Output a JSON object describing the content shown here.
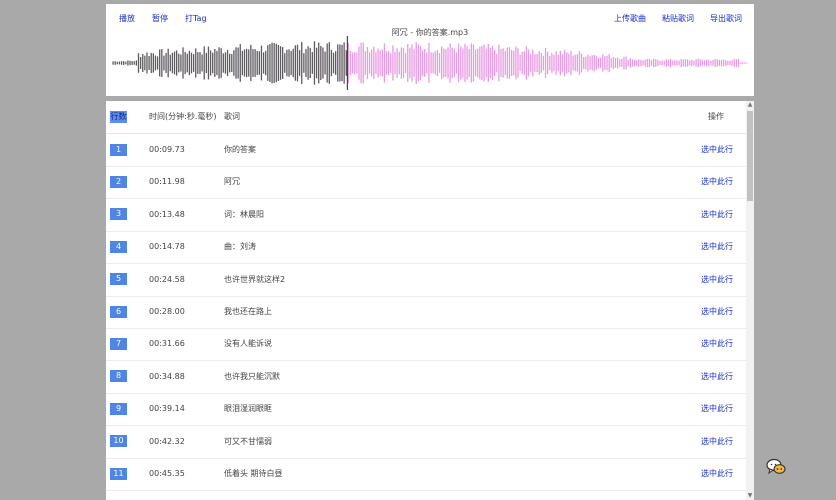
{
  "toolbar": {
    "play": "播放",
    "pause": "暂停",
    "tag": "打Tag",
    "upload": "上传歌曲",
    "paste": "粘贴歌词",
    "export": "导出歌词"
  },
  "track": {
    "title": "阿冗 - 你的答案.mp3",
    "playback_progress": 0.37,
    "played_color": "#5e5a60",
    "unplayed_color": "#e89ae3"
  },
  "table": {
    "headers": {
      "index": "行数",
      "time": "时间(分钟:秒.毫秒)",
      "lyric": "歌词",
      "action": "操作"
    },
    "rows": [
      {
        "index": "1",
        "time": "00:09.73",
        "lyric": "你的答案",
        "action": "选中此行"
      },
      {
        "index": "2",
        "time": "00:11.98",
        "lyric": "阿冗",
        "action": "选中此行"
      },
      {
        "index": "3",
        "time": "00:13.48",
        "lyric": "词：林晨阳",
        "action": "选中此行"
      },
      {
        "index": "4",
        "time": "00:14.78",
        "lyric": "曲：刘涛",
        "action": "选中此行"
      },
      {
        "index": "5",
        "time": "00:24.58",
        "lyric": "也许世界就这样2",
        "action": "选中此行"
      },
      {
        "index": "6",
        "time": "00:28.00",
        "lyric": "我也还在路上",
        "action": "选中此行"
      },
      {
        "index": "7",
        "time": "00:31.66",
        "lyric": "没有人能诉说",
        "action": "选中此行"
      },
      {
        "index": "8",
        "time": "00:34.88",
        "lyric": "也许我只能沉默",
        "action": "选中此行"
      },
      {
        "index": "9",
        "time": "00:39.14",
        "lyric": "眼泪湿润眼眶",
        "action": "选中此行"
      },
      {
        "index": "10",
        "time": "00:42.32",
        "lyric": "可又不甘懦弱",
        "action": "选中此行"
      },
      {
        "index": "11",
        "time": "00:45.35",
        "lyric": "低着头 期待白昼",
        "action": "选中此行"
      }
    ]
  },
  "icons": {
    "floating": "chat-bubbles-icon"
  }
}
